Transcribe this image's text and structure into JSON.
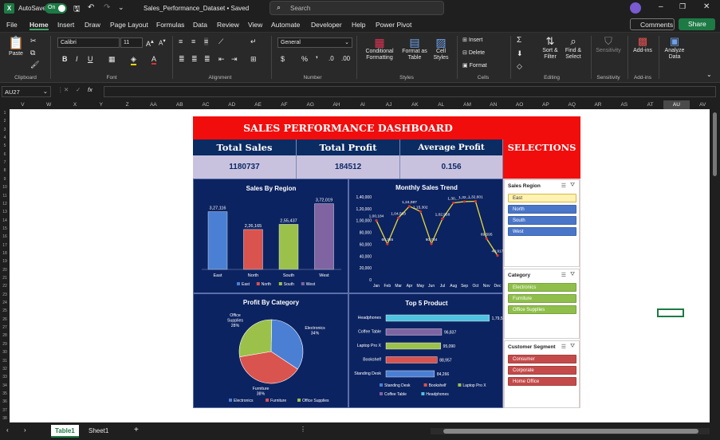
{
  "titlebar": {
    "autosave_label": "AutoSave",
    "autosave_state": "On",
    "file_title": "Sales_Performance_Dataset • Saved",
    "search_placeholder": "Search"
  },
  "menu": [
    "File",
    "Home",
    "Insert",
    "Draw",
    "Page Layout",
    "Formulas",
    "Data",
    "Review",
    "View",
    "Automate",
    "Developer",
    "Help",
    "Power Pivot"
  ],
  "menu_right": {
    "comments": "Comments",
    "share": "Share"
  },
  "ribbon": {
    "paste": "Paste",
    "clipboard": "Clipboard",
    "font_name": "Calibri",
    "font_size": "11",
    "font_group": "Font",
    "alignment": "Alignment",
    "number_format": "General",
    "number_group": "Number",
    "cond_format": "Conditional Formatting",
    "format_table": "Format as Table",
    "cell_styles": "Cell Styles",
    "styles_group": "Styles",
    "insert": "Insert",
    "delete": "Delete",
    "format": "Format",
    "cells_group": "Cells",
    "sort_filter": "Sort & Filter",
    "find_select": "Find & Select",
    "editing_group": "Editing",
    "sensitivity": "Sensitivity",
    "sensitivity_group": "Sensitivity",
    "addins": "Add-ins",
    "addins_group": "Add-ins",
    "analyze": "Analyze Data"
  },
  "formula": {
    "name_box": "AU27",
    "fx": "fx",
    "content": ""
  },
  "columns": [
    "V",
    "W",
    "X",
    "Y",
    "Z",
    "AA",
    "AB",
    "AC",
    "AD",
    "AE",
    "AF",
    "AG",
    "AH",
    "AI",
    "AJ",
    "AK",
    "AL",
    "AM",
    "AN",
    "AO",
    "AP",
    "AQ",
    "AR",
    "AS",
    "AT",
    "AU",
    "AV"
  ],
  "active_column": "AU",
  "dashboard": {
    "title": "SALES PERFORMANCE DASHBOARD",
    "selections": "SELECTIONS",
    "kpis": [
      {
        "label": "Total Sales",
        "value": "1180737"
      },
      {
        "label": "Total Profit",
        "value": "184512"
      },
      {
        "label": "Average Profit Margin",
        "value": "0.156"
      }
    ]
  },
  "slicers": [
    {
      "title": "Sales Region",
      "items": [
        "East",
        "North",
        "South",
        "West"
      ],
      "colors": [
        "#fff2b3",
        "#4a76c9",
        "#4a76c9",
        "#4a76c9"
      ],
      "text_colors": [
        "#333",
        "#fff",
        "#fff",
        "#fff"
      ]
    },
    {
      "title": "Category",
      "items": [
        "Electronics",
        "Furniture",
        "Office Supplies"
      ],
      "colors": [
        "#8fbf4a",
        "#8fbf4a",
        "#8fbf4a"
      ],
      "text_colors": [
        "#fff",
        "#fff",
        "#fff"
      ]
    },
    {
      "title": "Customer Segment",
      "items": [
        "Consumer",
        "Corporate",
        "Home Office"
      ],
      "colors": [
        "#c44a4a",
        "#c44a4a",
        "#c44a4a"
      ],
      "text_colors": [
        "#fff",
        "#fff",
        "#fff"
      ]
    }
  ],
  "sheets": {
    "tabs": [
      "Table1",
      "Sheet1"
    ],
    "active": "Table1"
  },
  "chart_data": [
    {
      "type": "bar",
      "title": "Sales By Region",
      "categories": [
        "East",
        "North",
        "South",
        "West"
      ],
      "values": [
        327116,
        226165,
        255437,
        372019
      ],
      "labels": [
        "3,27,116",
        "2,26,165",
        "2,55,437",
        "3,72,019"
      ],
      "colors": [
        "#4a7fd4",
        "#d9534f",
        "#9cc14a",
        "#8064a2"
      ],
      "legend": [
        "East",
        "North",
        "South",
        "West"
      ]
    },
    {
      "type": "line",
      "title": "Monthly Sales Trend",
      "categories": [
        "Jan",
        "Feb",
        "Mar",
        "Apr",
        "May",
        "Jun",
        "Jul",
        "Aug",
        "Sep",
        "Oct",
        "Nov",
        "Dec"
      ],
      "values": [
        100184,
        60365,
        104503,
        124087,
        115302,
        60744,
        102958,
        130000,
        132000,
        132601,
        69595,
        40917
      ],
      "labels": [
        "1,00,184",
        "60,365",
        "1,04,503",
        "1,24,087",
        "1,15,302",
        "60,744",
        "1,02,958",
        "1,30,...",
        "1,32,...",
        "1,32,601",
        "69,595",
        "40,917"
      ],
      "yticks": [
        "0",
        "20,000",
        "40,000",
        "60,000",
        "80,000",
        "1,00,000",
        "1,20,000",
        "1,40,000"
      ],
      "ylim": [
        0,
        140000
      ],
      "line_color": "#e6d93a",
      "marker_color": "#e03030"
    },
    {
      "type": "pie",
      "title": "Profit By Category",
      "categories": [
        "Electronics",
        "Furniture",
        "Office Supplies"
      ],
      "values": [
        34,
        38,
        28
      ],
      "labels": [
        "Electronics 34%",
        "Furniture 38%",
        "Office Supplies 28%"
      ],
      "colors": [
        "#4a7fd4",
        "#d9534f",
        "#9cc14a"
      ],
      "legend": [
        "Electronics",
        "Furniture",
        "Office Supplies"
      ]
    },
    {
      "type": "bar",
      "title": "Top 5 Product",
      "orientation": "horizontal",
      "categories": [
        "Headphones",
        "Coffee Table",
        "Laptop Pro X",
        "Bookshelf",
        "Standing Desk"
      ],
      "values": [
        179526,
        96837,
        95090,
        88957,
        84266
      ],
      "labels": [
        "1,79,526",
        "96,837",
        "95,090",
        "88,957",
        "84,266"
      ],
      "colors": [
        "#4fc3e0",
        "#8064a2",
        "#9cc14a",
        "#d9534f",
        "#4a7fd4"
      ],
      "legend": [
        "Standing Desk",
        "Bookshelf",
        "Laptop Pro X",
        "Coffee Table",
        "Headphones"
      ]
    }
  ]
}
